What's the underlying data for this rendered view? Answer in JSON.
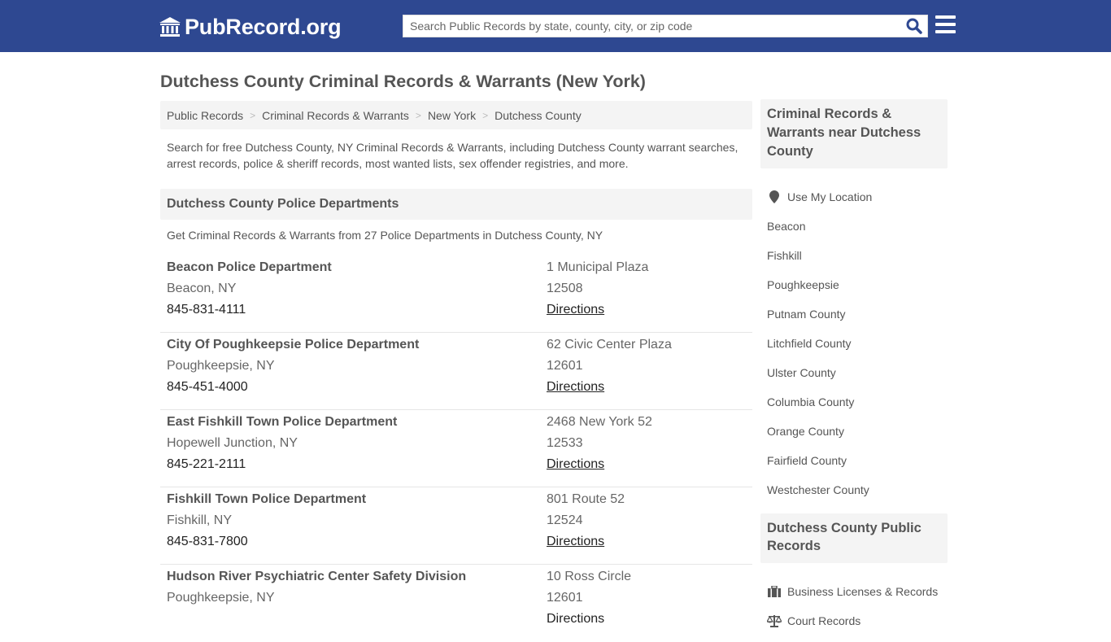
{
  "header": {
    "logo_text": "PubRecord.org",
    "search_placeholder": "Search Public Records by state, county, city, or zip code",
    "search_value": "",
    "brand_color": "#2e4891"
  },
  "page": {
    "title": "Dutchess County Criminal Records & Warrants (New York)",
    "breadcrumb": [
      {
        "label": "Public Records"
      },
      {
        "label": "Criminal Records & Warrants"
      },
      {
        "label": "New York"
      },
      {
        "label": "Dutchess County"
      }
    ],
    "breadcrumb_sep": ">",
    "intro": "Search for free Dutchess County, NY Criminal Records & Warrants, including Dutchess County warrant searches, arrest records, police & sheriff records, most wanted lists, sex offender registries, and more."
  },
  "departments_section": {
    "heading": "Dutchess County Police Departments",
    "subheading": "Get Criminal Records & Warrants from 27 Police Departments in Dutchess County, NY",
    "items": [
      {
        "name": "Beacon Police Department",
        "city": "Beacon, NY",
        "phone": "845-831-4111",
        "address": "1 Municipal Plaza",
        "zip": "12508",
        "directions": "Directions"
      },
      {
        "name": "City Of Poughkeepsie Police Department",
        "city": "Poughkeepsie, NY",
        "phone": "845-451-4000",
        "address": "62 Civic Center Plaza",
        "zip": "12601",
        "directions": "Directions"
      },
      {
        "name": "East Fishkill Town Police Department",
        "city": "Hopewell Junction, NY",
        "phone": "845-221-2111",
        "address": "2468 New York 52",
        "zip": "12533",
        "directions": "Directions"
      },
      {
        "name": "Fishkill Town Police Department",
        "city": "Fishkill, NY",
        "phone": "845-831-7800",
        "address": "801 Route 52",
        "zip": "12524",
        "directions": "Directions"
      },
      {
        "name": "Hudson River Psychiatric Center Safety Division",
        "city": "Poughkeepsie, NY",
        "phone": "",
        "address": "10 Ross Circle",
        "zip": "12601",
        "directions": "Directions"
      }
    ]
  },
  "sidebar": {
    "nearby": {
      "heading": "Criminal Records & Warrants near Dutchess County",
      "use_location": "Use My Location",
      "items": [
        "Beacon",
        "Fishkill",
        "Poughkeepsie",
        "Putnam County",
        "Litchfield County",
        "Ulster County",
        "Columbia County",
        "Orange County",
        "Fairfield County",
        "Westchester County"
      ]
    },
    "public_records": {
      "heading": "Dutchess County Public Records",
      "items": [
        {
          "label": "Business Licenses & Records",
          "icon": "briefcase-icon"
        },
        {
          "label": "Court Records",
          "icon": "scale-icon"
        }
      ]
    }
  }
}
